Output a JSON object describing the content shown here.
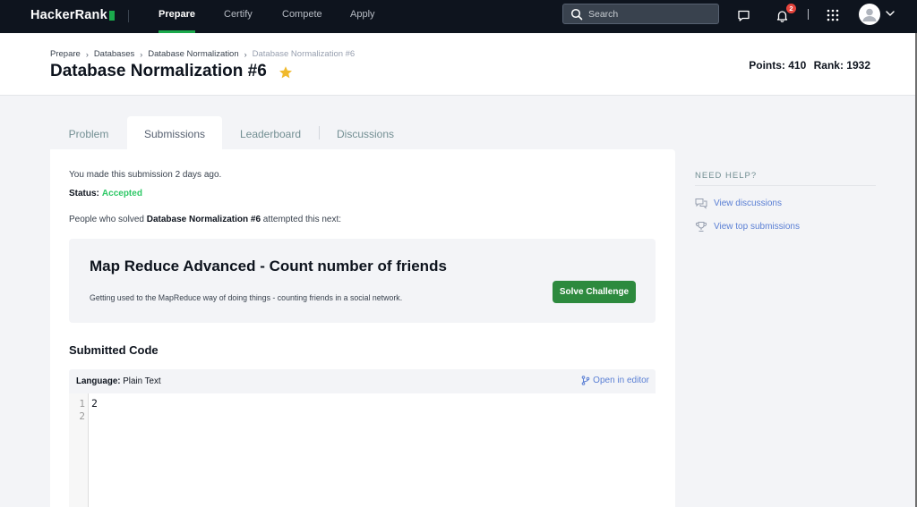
{
  "nav": {
    "logo": "HackerRank",
    "links": [
      "Prepare",
      "Certify",
      "Compete",
      "Apply"
    ],
    "active": "Prepare",
    "search_placeholder": "Search",
    "notification_count": "2"
  },
  "header": {
    "breadcrumb": [
      "Prepare",
      "Databases",
      "Database Normalization",
      "Database Normalization #6"
    ],
    "title": "Database Normalization #6",
    "points_label": "Points: 410",
    "rank_label": "Rank: 1932"
  },
  "tabs": [
    "Problem",
    "Submissions",
    "Leaderboard",
    "Discussions"
  ],
  "active_tab": "Submissions",
  "submission": {
    "made_text": "You made this submission 2 days ago.",
    "status_label": "Status:",
    "status_value": "Accepted",
    "solved_prefix": "People who solved",
    "solved_challenge": "Database Normalization #6",
    "solved_suffix": "attempted this next:"
  },
  "next_challenge": {
    "title": "Map Reduce Advanced - Count number of friends",
    "description": "Getting used to the MapReduce way of doing things - counting friends in a social network.",
    "button": "Solve Challenge"
  },
  "code": {
    "heading": "Submitted Code",
    "language_label": "Language:",
    "language_value": "Plain Text",
    "open_editor": "Open in editor",
    "line_numbers": [
      "1",
      "2"
    ],
    "lines": [
      "2",
      ""
    ]
  },
  "help": {
    "heading": "NEED HELP?",
    "links": [
      "View discussions",
      "View top submissions"
    ]
  },
  "colors": {
    "nav_bg": "#0e141e",
    "brand_green": "#1ba94c",
    "accepted_green": "#2ec866",
    "button_green": "#2d8a3e",
    "link_blue": "#5a7fd4",
    "star_yellow": "#ffc32b"
  }
}
